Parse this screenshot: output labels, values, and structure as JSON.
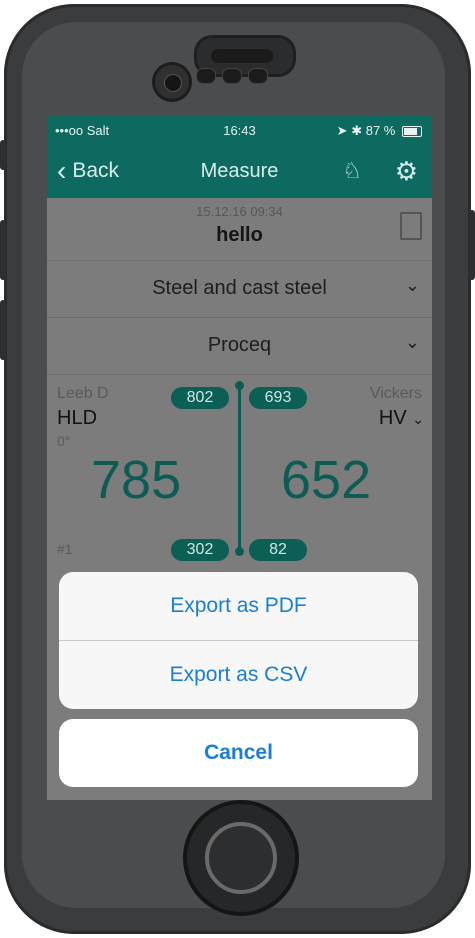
{
  "status": {
    "carrier": "•••oo Salt",
    "time": "16:43",
    "battery": "87 %"
  },
  "nav": {
    "back_label": "Back",
    "title": "Measure"
  },
  "header": {
    "timestamp": "15.12.16 09:34",
    "name": "hello"
  },
  "material": {
    "value": "Steel and cast steel"
  },
  "probe": {
    "value": "Proceq"
  },
  "measurement": {
    "left_scale": "Leeb D",
    "left_unit": "HLD",
    "angle": "0°",
    "right_scale": "Vickers",
    "right_unit": "HV",
    "left_max": "802",
    "right_max": "693",
    "left_value": "785",
    "right_value": "652",
    "left_min": "302",
    "right_min": "82",
    "index": "#1"
  },
  "behind": {
    "left": "785",
    "right": "652"
  },
  "sheet": {
    "pdf": "Export as PDF",
    "csv": "Export as CSV",
    "cancel": "Cancel"
  },
  "colors": {
    "brand": "#0c6a60",
    "accent": "#1a7fd4"
  }
}
